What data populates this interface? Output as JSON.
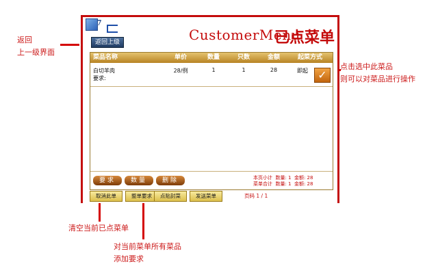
{
  "window": {
    "title_en": "CustomerMenu",
    "title_zh": "已点菜单",
    "logo_glyph": "7",
    "back_button": "返回上级"
  },
  "table": {
    "headers": [
      "菜品名称",
      "单价",
      "数量",
      "只数",
      "金额",
      "起菜方式"
    ],
    "rows": [
      {
        "name": "白切羊肉",
        "note": "要求:",
        "price": "28/例",
        "qty": "1",
        "count": "1",
        "amount": "28",
        "serve": "即起"
      }
    ],
    "check_mark": "✓"
  },
  "actions": {
    "request": "要求",
    "quantity": "数量",
    "delete": "删除"
  },
  "summary": {
    "page_label": "本页小计",
    "page_qty": "数量: 1",
    "page_amount": "金额: 28",
    "menu_label": "菜单合计",
    "menu_qty": "数量: 1",
    "menu_amount": "金额: 28"
  },
  "footer": {
    "clear_button": "取消此单",
    "order_request_button": "整单要求",
    "seal_button": "点贴封菜",
    "send_button": "发送菜单",
    "pager": "页码 1 / 1"
  },
  "annotations": {
    "back_1": "返回",
    "back_2": "上一级界面",
    "select_1": "点击选中此菜品",
    "select_2": "则可以对菜品进行操作",
    "clear": "清空当前已点菜单",
    "request_1": "对当前菜单所有菜品",
    "request_2": "添加要求"
  },
  "colors": {
    "accent": "#c40b0b",
    "header_gold": "#c89838",
    "button_brown": "#8a4607"
  }
}
